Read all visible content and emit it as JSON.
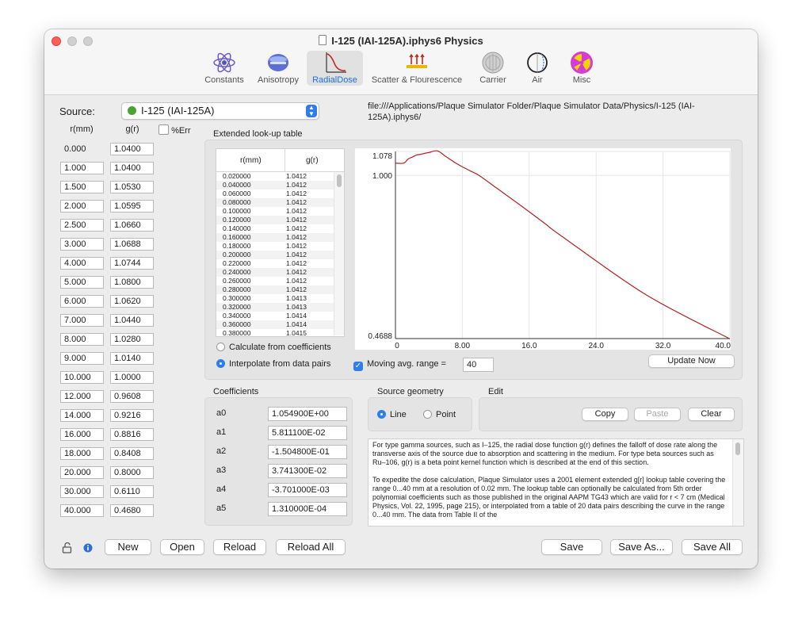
{
  "window": {
    "title": "I-125 (IAI-125A).iphys6 Physics"
  },
  "toolbar": [
    {
      "label": "Constants",
      "icon": "atom-icon",
      "active": false
    },
    {
      "label": "Anisotropy",
      "icon": "anisotropy-icon",
      "active": false
    },
    {
      "label": "RadialDose",
      "icon": "radial-dose-icon",
      "active": true
    },
    {
      "label": "Scatter & Flourescence",
      "icon": "scatter-icon",
      "active": false
    },
    {
      "label": "Carrier",
      "icon": "carrier-icon",
      "active": false
    },
    {
      "label": "Air",
      "icon": "air-icon",
      "active": false
    },
    {
      "label": "Misc",
      "icon": "radiation-icon",
      "active": false
    }
  ],
  "source": {
    "label": "Source:",
    "value": "I-125 (IAI-125A)"
  },
  "file_path": "file:///Applications/Plaque Simulator Folder/Plaque Simulator Data/Physics/I-125 (IAI-125A).iphys6/",
  "pairs": {
    "col_r": "r(mm)",
    "col_g": "g(r)",
    "err_label": "%Err",
    "rows": [
      [
        "0.000",
        "1.0400"
      ],
      [
        "1.000",
        "1.0400"
      ],
      [
        "1.500",
        "1.0530"
      ],
      [
        "2.000",
        "1.0595"
      ],
      [
        "2.500",
        "1.0660"
      ],
      [
        "3.000",
        "1.0688"
      ],
      [
        "4.000",
        "1.0744"
      ],
      [
        "5.000",
        "1.0800"
      ],
      [
        "6.000",
        "1.0620"
      ],
      [
        "7.000",
        "1.0440"
      ],
      [
        "8.000",
        "1.0280"
      ],
      [
        "9.000",
        "1.0140"
      ],
      [
        "10.000",
        "1.0000"
      ],
      [
        "12.000",
        "0.9608"
      ],
      [
        "14.000",
        "0.9216"
      ],
      [
        "16.000",
        "0.8816"
      ],
      [
        "18.000",
        "0.8408"
      ],
      [
        "20.000",
        "0.8000"
      ],
      [
        "30.000",
        "0.6110"
      ],
      [
        "40.000",
        "0.4680"
      ]
    ]
  },
  "lookup": {
    "title": "Extended look-up table",
    "col_r": "r(mm)",
    "col_g": "g(r)",
    "rows": [
      [
        "0.020000",
        "1.0412"
      ],
      [
        "0.040000",
        "1.0412"
      ],
      [
        "0.060000",
        "1.0412"
      ],
      [
        "0.080000",
        "1.0412"
      ],
      [
        "0.100000",
        "1.0412"
      ],
      [
        "0.120000",
        "1.0412"
      ],
      [
        "0.140000",
        "1.0412"
      ],
      [
        "0.160000",
        "1.0412"
      ],
      [
        "0.180000",
        "1.0412"
      ],
      [
        "0.200000",
        "1.0412"
      ],
      [
        "0.220000",
        "1.0412"
      ],
      [
        "0.240000",
        "1.0412"
      ],
      [
        "0.260000",
        "1.0412"
      ],
      [
        "0.280000",
        "1.0412"
      ],
      [
        "0.300000",
        "1.0413"
      ],
      [
        "0.320000",
        "1.0413"
      ],
      [
        "0.340000",
        "1.0414"
      ],
      [
        "0.360000",
        "1.0414"
      ],
      [
        "0.380000",
        "1.0415"
      ]
    ],
    "calc_label": "Calculate from coefficients",
    "interp_label": "Interpolate from data pairs",
    "moving_avg_label": "Moving avg. range =",
    "moving_avg_value": "40",
    "update_label": "Update Now"
  },
  "chart_data": {
    "type": "line",
    "x": [
      0,
      1,
      1.5,
      2,
      2.5,
      3,
      4,
      5,
      6,
      7,
      8,
      9,
      10,
      12,
      14,
      16,
      18,
      20,
      30,
      40
    ],
    "y": [
      1.04,
      1.04,
      1.053,
      1.0595,
      1.066,
      1.0688,
      1.0744,
      1.08,
      1.062,
      1.044,
      1.028,
      1.014,
      1.0,
      0.9608,
      0.9216,
      0.8816,
      0.8408,
      0.8,
      0.611,
      0.468
    ],
    "xlim": [
      0,
      40
    ],
    "ylim": [
      0.4688,
      1.078
    ],
    "x_ticks": [
      "0",
      "8.00",
      "16.0",
      "24.0",
      "32.0",
      "40.0"
    ],
    "y_ticks": [
      "1.078",
      "1.000",
      "0.4688"
    ],
    "color": "#b22222",
    "grid": true
  },
  "coefficients": {
    "title": "Coefficients",
    "rows": [
      {
        "name": "a0",
        "value": "1.054900E+00"
      },
      {
        "name": "a1",
        "value": "5.811100E-02"
      },
      {
        "name": "a2",
        "value": "-1.504800E-01"
      },
      {
        "name": "a3",
        "value": "3.741300E-02"
      },
      {
        "name": "a4",
        "value": "-3.701000E-03"
      },
      {
        "name": "a5",
        "value": "1.310000E-04"
      }
    ]
  },
  "geometry": {
    "title": "Source geometry",
    "line_label": "Line",
    "point_label": "Point"
  },
  "edit": {
    "title": "Edit",
    "copy": "Copy",
    "paste": "Paste",
    "clear": "Clear"
  },
  "description": {
    "p1": "For type gamma sources, such as I–125, the radial dose function g(r) defines the falloff of dose rate along the transverse axis of the source due to absorption and scattering in the medium. For type beta sources such as Ru–106,  g(r) is a beta point kernel function which is described at the end of this section.",
    "p2": " To expedite the dose calculation, Plaque Simulator uses a 2001 element extended g[r] lookup table covering the range 0...40 mm at a resolution of 0.02 mm. The lookup table can optionally be calculated from 5th order polynomial coefficients such as those published in the original AAPM TG43 which are valid for r < 7 cm (Medical Physics, Vol. 22, 1995, page 215), or interpolated from a table of 20 data pairs describing the curve in the range 0...40 mm. The data from Table II of the"
  },
  "buttons": {
    "new": "New",
    "open": "Open",
    "reload": "Reload",
    "reload_all": "Reload All",
    "save": "Save",
    "save_as": "Save As...",
    "save_all": "Save All"
  }
}
